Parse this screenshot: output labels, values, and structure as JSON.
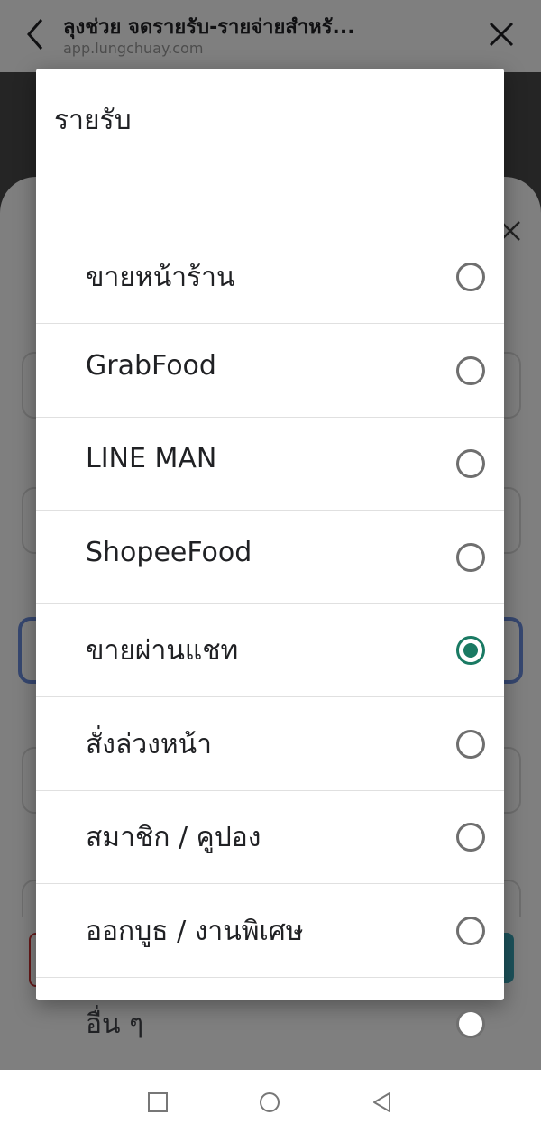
{
  "browser": {
    "title": "ลุงช่วย จดรายรับ-รายจ่ายสำหรั...",
    "url": "app.lungchuay.com",
    "icons": {
      "back": "chevron-left-icon",
      "close": "close-icon"
    }
  },
  "dialog": {
    "title": "รายรับ",
    "selected_index": 4,
    "options": [
      {
        "label": "ขายหน้าร้าน",
        "selected": false
      },
      {
        "label": "GrabFood",
        "selected": false
      },
      {
        "label": "LINE MAN",
        "selected": false
      },
      {
        "label": "ShopeeFood",
        "selected": false
      },
      {
        "label": "ขายผ่านแชท",
        "selected": true
      },
      {
        "label": "สั่งล่วงหน้า",
        "selected": false
      },
      {
        "label": "สมาชิก / คูปอง",
        "selected": false
      },
      {
        "label": "ออกบูธ / งานพิเศษ",
        "selected": false
      },
      {
        "label": "อื่น ๆ",
        "selected": false
      }
    ]
  },
  "colors": {
    "accent": "#1a7a63",
    "radio_unchecked": "#6f6f6f",
    "scrim": "rgba(0,0,0,0.5)"
  },
  "navbar": {
    "icons": [
      "recent-apps-icon",
      "home-icon",
      "back-triangle-icon"
    ]
  }
}
